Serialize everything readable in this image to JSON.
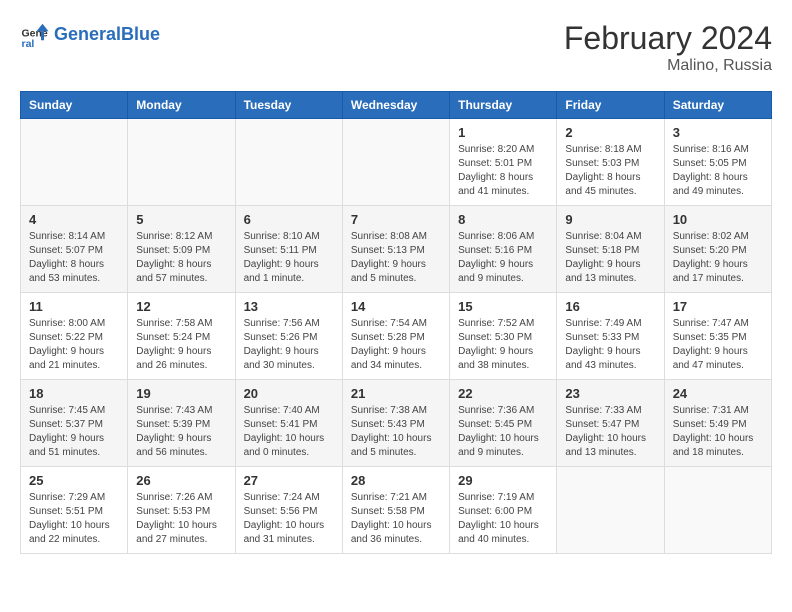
{
  "logo": {
    "text_general": "General",
    "text_blue": "Blue"
  },
  "title": "February 2024",
  "subtitle": "Malino, Russia",
  "days_of_week": [
    "Sunday",
    "Monday",
    "Tuesday",
    "Wednesday",
    "Thursday",
    "Friday",
    "Saturday"
  ],
  "weeks": [
    [
      {
        "day": "",
        "content": ""
      },
      {
        "day": "",
        "content": ""
      },
      {
        "day": "",
        "content": ""
      },
      {
        "day": "",
        "content": ""
      },
      {
        "day": "1",
        "content": "Sunrise: 8:20 AM\nSunset: 5:01 PM\nDaylight: 8 hours\nand 41 minutes."
      },
      {
        "day": "2",
        "content": "Sunrise: 8:18 AM\nSunset: 5:03 PM\nDaylight: 8 hours\nand 45 minutes."
      },
      {
        "day": "3",
        "content": "Sunrise: 8:16 AM\nSunset: 5:05 PM\nDaylight: 8 hours\nand 49 minutes."
      }
    ],
    [
      {
        "day": "4",
        "content": "Sunrise: 8:14 AM\nSunset: 5:07 PM\nDaylight: 8 hours\nand 53 minutes."
      },
      {
        "day": "5",
        "content": "Sunrise: 8:12 AM\nSunset: 5:09 PM\nDaylight: 8 hours\nand 57 minutes."
      },
      {
        "day": "6",
        "content": "Sunrise: 8:10 AM\nSunset: 5:11 PM\nDaylight: 9 hours\nand 1 minute."
      },
      {
        "day": "7",
        "content": "Sunrise: 8:08 AM\nSunset: 5:13 PM\nDaylight: 9 hours\nand 5 minutes."
      },
      {
        "day": "8",
        "content": "Sunrise: 8:06 AM\nSunset: 5:16 PM\nDaylight: 9 hours\nand 9 minutes."
      },
      {
        "day": "9",
        "content": "Sunrise: 8:04 AM\nSunset: 5:18 PM\nDaylight: 9 hours\nand 13 minutes."
      },
      {
        "day": "10",
        "content": "Sunrise: 8:02 AM\nSunset: 5:20 PM\nDaylight: 9 hours\nand 17 minutes."
      }
    ],
    [
      {
        "day": "11",
        "content": "Sunrise: 8:00 AM\nSunset: 5:22 PM\nDaylight: 9 hours\nand 21 minutes."
      },
      {
        "day": "12",
        "content": "Sunrise: 7:58 AM\nSunset: 5:24 PM\nDaylight: 9 hours\nand 26 minutes."
      },
      {
        "day": "13",
        "content": "Sunrise: 7:56 AM\nSunset: 5:26 PM\nDaylight: 9 hours\nand 30 minutes."
      },
      {
        "day": "14",
        "content": "Sunrise: 7:54 AM\nSunset: 5:28 PM\nDaylight: 9 hours\nand 34 minutes."
      },
      {
        "day": "15",
        "content": "Sunrise: 7:52 AM\nSunset: 5:30 PM\nDaylight: 9 hours\nand 38 minutes."
      },
      {
        "day": "16",
        "content": "Sunrise: 7:49 AM\nSunset: 5:33 PM\nDaylight: 9 hours\nand 43 minutes."
      },
      {
        "day": "17",
        "content": "Sunrise: 7:47 AM\nSunset: 5:35 PM\nDaylight: 9 hours\nand 47 minutes."
      }
    ],
    [
      {
        "day": "18",
        "content": "Sunrise: 7:45 AM\nSunset: 5:37 PM\nDaylight: 9 hours\nand 51 minutes."
      },
      {
        "day": "19",
        "content": "Sunrise: 7:43 AM\nSunset: 5:39 PM\nDaylight: 9 hours\nand 56 minutes."
      },
      {
        "day": "20",
        "content": "Sunrise: 7:40 AM\nSunset: 5:41 PM\nDaylight: 10 hours\nand 0 minutes."
      },
      {
        "day": "21",
        "content": "Sunrise: 7:38 AM\nSunset: 5:43 PM\nDaylight: 10 hours\nand 5 minutes."
      },
      {
        "day": "22",
        "content": "Sunrise: 7:36 AM\nSunset: 5:45 PM\nDaylight: 10 hours\nand 9 minutes."
      },
      {
        "day": "23",
        "content": "Sunrise: 7:33 AM\nSunset: 5:47 PM\nDaylight: 10 hours\nand 13 minutes."
      },
      {
        "day": "24",
        "content": "Sunrise: 7:31 AM\nSunset: 5:49 PM\nDaylight: 10 hours\nand 18 minutes."
      }
    ],
    [
      {
        "day": "25",
        "content": "Sunrise: 7:29 AM\nSunset: 5:51 PM\nDaylight: 10 hours\nand 22 minutes."
      },
      {
        "day": "26",
        "content": "Sunrise: 7:26 AM\nSunset: 5:53 PM\nDaylight: 10 hours\nand 27 minutes."
      },
      {
        "day": "27",
        "content": "Sunrise: 7:24 AM\nSunset: 5:56 PM\nDaylight: 10 hours\nand 31 minutes."
      },
      {
        "day": "28",
        "content": "Sunrise: 7:21 AM\nSunset: 5:58 PM\nDaylight: 10 hours\nand 36 minutes."
      },
      {
        "day": "29",
        "content": "Sunrise: 7:19 AM\nSunset: 6:00 PM\nDaylight: 10 hours\nand 40 minutes."
      },
      {
        "day": "",
        "content": ""
      },
      {
        "day": "",
        "content": ""
      }
    ]
  ]
}
